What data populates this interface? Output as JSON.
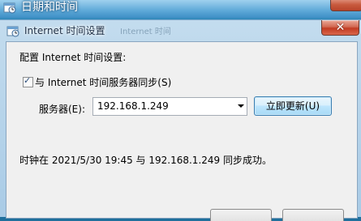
{
  "parent_window": {
    "title": "日期和时间"
  },
  "dialog": {
    "title": "Internet 时间设置",
    "title_ghost": "Internet 时间",
    "close_glyph": "✕",
    "heading": "配置 Internet 时间设置:",
    "sync_checkbox": {
      "checked": true,
      "check_glyph": "✓",
      "label": "与 Internet 时间服务器同步(S)"
    },
    "server": {
      "label": "服务器(E):",
      "value": "192.168.1.249"
    },
    "update_button": "立即更新(U)",
    "status_text": "时钟在 2021/5/30 19:45 与 192.168.1.249 同步成功。"
  }
}
